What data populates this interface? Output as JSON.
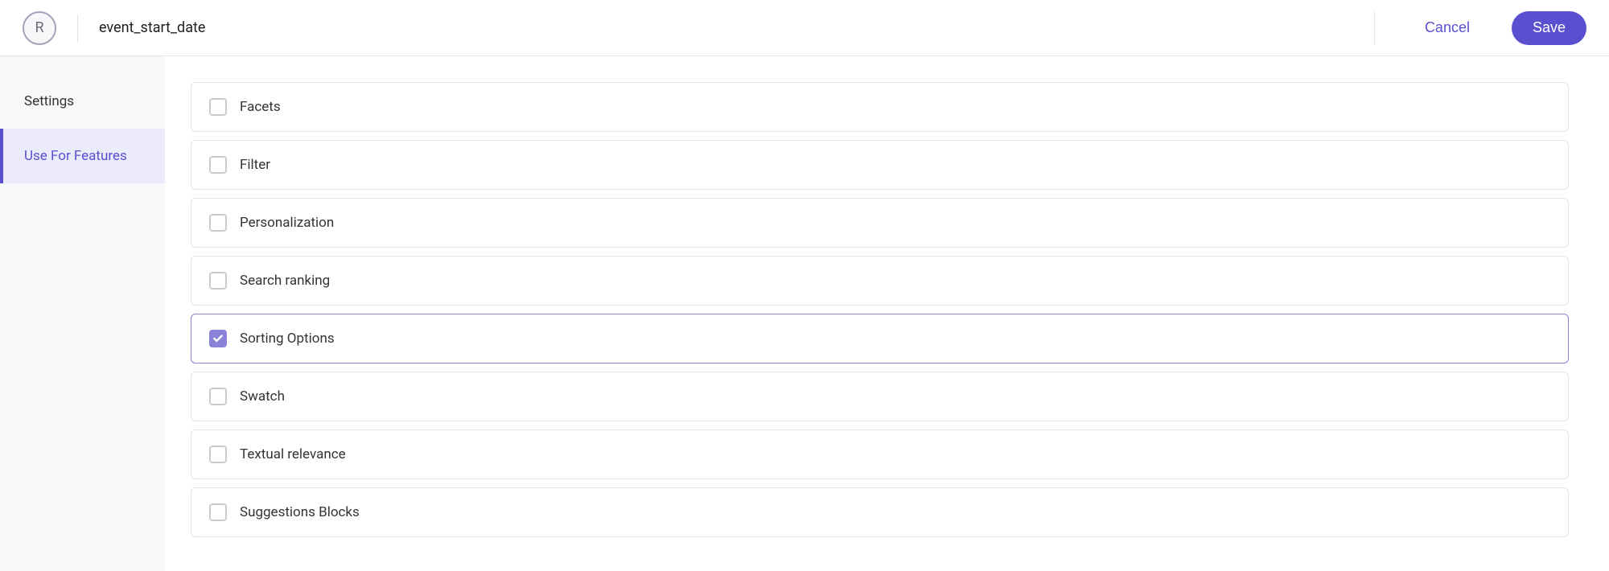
{
  "header": {
    "avatar_initial": "R",
    "title": "event_start_date",
    "cancel_label": "Cancel",
    "save_label": "Save"
  },
  "sidebar": {
    "items": [
      {
        "label": "Settings",
        "active": false
      },
      {
        "label": "Use For Features",
        "active": true
      }
    ]
  },
  "features": [
    {
      "label": "Facets",
      "checked": false
    },
    {
      "label": "Filter",
      "checked": false
    },
    {
      "label": "Personalization",
      "checked": false
    },
    {
      "label": "Search ranking",
      "checked": false
    },
    {
      "label": "Sorting Options",
      "checked": true
    },
    {
      "label": "Swatch",
      "checked": false
    },
    {
      "label": "Textual relevance",
      "checked": false
    },
    {
      "label": "Suggestions Blocks",
      "checked": false
    }
  ]
}
